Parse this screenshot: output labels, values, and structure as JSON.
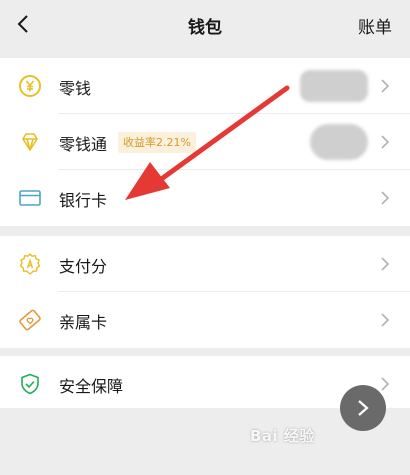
{
  "header": {
    "title": "钱包",
    "right_link": "账单"
  },
  "section1": [
    {
      "label": "零钱",
      "icon": "yuan-coin-icon"
    },
    {
      "label": "零钱通",
      "icon": "diamond-icon",
      "badge": "收益率2.21%"
    },
    {
      "label": "银行卡",
      "icon": "bank-card-icon"
    }
  ],
  "section2": [
    {
      "label": "支付分",
      "icon": "pay-score-badge-icon"
    },
    {
      "label": "亲属卡",
      "icon": "family-card-icon"
    }
  ],
  "section3": [
    {
      "label": "安全保障",
      "icon": "shield-check-icon"
    }
  ],
  "watermark": "Bai 经验",
  "colors": {
    "icon_yellow": "#e8bf27",
    "icon_blue": "#4aa6c2",
    "icon_orange": "#e9973b",
    "icon_green": "#1fae5a",
    "arrow_red": "#e53935",
    "badge_bg": "#fbf0dc",
    "badge_text": "#d69a2b"
  }
}
